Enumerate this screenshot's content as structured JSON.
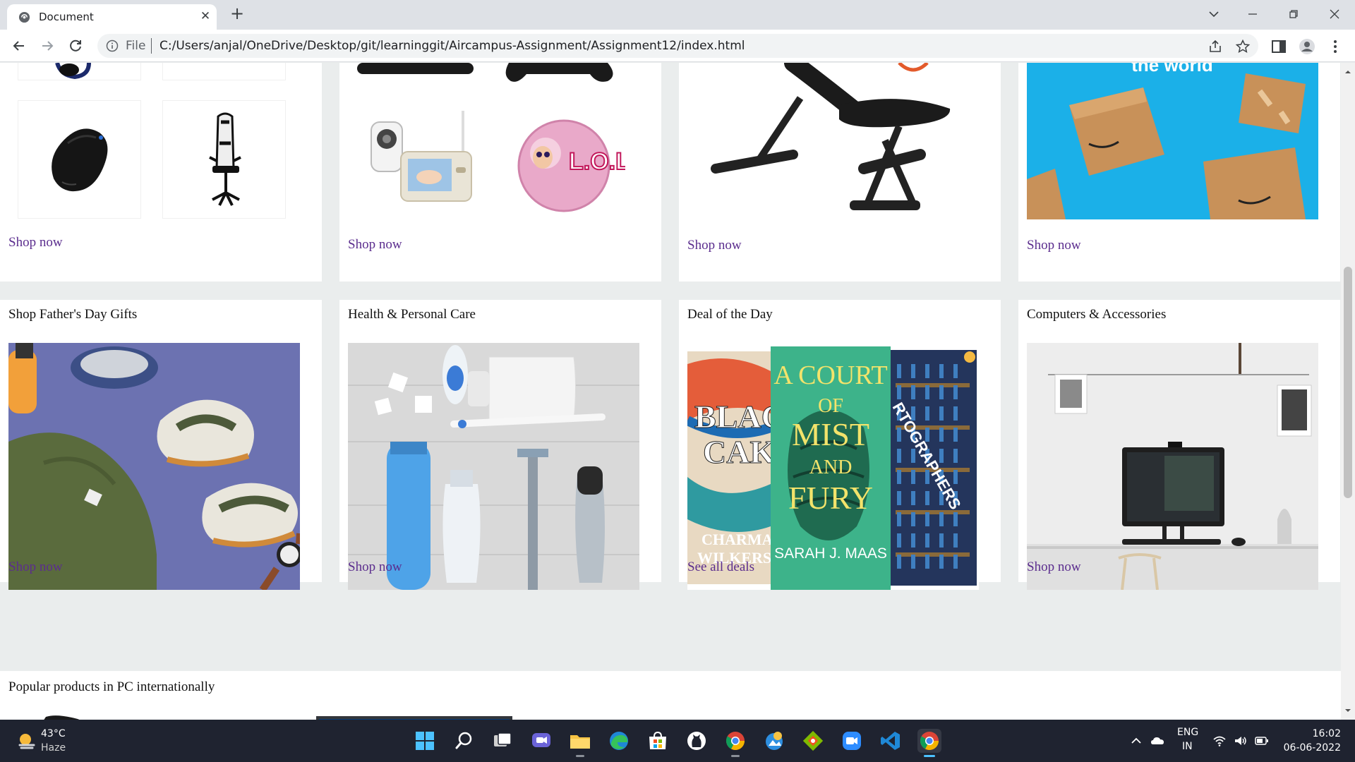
{
  "browser": {
    "tab_title": "Document",
    "tab_close": "✕",
    "new_tab": "+",
    "address_scheme": "File",
    "address_url": "C:/Users/anjal/OneDrive/Desktop/git/learninggit/Aircampus-Assignment/Assignment12/index.html"
  },
  "cards_top": [
    {
      "link": "Shop now"
    },
    {
      "link": "Shop now"
    },
    {
      "link": "Shop now"
    },
    {
      "link": "Shop now",
      "banner_text": "the world"
    }
  ],
  "cards_middle": [
    {
      "title": "Shop Father's Day Gifts",
      "link": "Shop now"
    },
    {
      "title": "Health & Personal Care",
      "link": "Shop now"
    },
    {
      "title": "Deal of the Day",
      "link": "See all deals"
    },
    {
      "title": "Computers & Accessories",
      "link": "Shop now"
    }
  ],
  "books": {
    "left_title_1": "BLAC",
    "left_title_2": "CAK",
    "left_author_1": "CHARMAI",
    "left_author_2": "WILKERS",
    "center_title_1": "A COURT",
    "center_title_2": "OF",
    "center_title_3": "MIST",
    "center_title_4": "AND",
    "center_title_5": "FURY",
    "center_author": "SARAH J. MAAS",
    "right_title": "RTOGRAPHERS"
  },
  "toy_label": "L.O.L.",
  "popular_title": "Popular products in PC internationally",
  "taskbar": {
    "temperature": "43°C",
    "weather": "Haze",
    "lang_1": "ENG",
    "lang_2": "IN",
    "time": "16:02",
    "date": "06-06-2022"
  },
  "colors": {
    "link": "#5b2d8e",
    "page_bg": "#eaeded",
    "taskbar_bg": "#1f2330",
    "amazon_blue": "#1bb0e8"
  },
  "icons": [
    "document-favicon",
    "back-icon",
    "forward-icon",
    "reload-icon",
    "info-icon",
    "share-icon",
    "star-icon",
    "sidebar-icon",
    "profile-icon",
    "menu-icon",
    "weather-icon",
    "windows-start-icon",
    "search-icon",
    "task-view-icon",
    "chat-icon",
    "file-explorer-icon",
    "edge-icon",
    "store-icon",
    "github-icon",
    "chrome-icon",
    "photos-icon",
    "git-icon",
    "zoom-icon",
    "vscode-icon",
    "wifi-icon",
    "volume-icon",
    "battery-icon"
  ]
}
